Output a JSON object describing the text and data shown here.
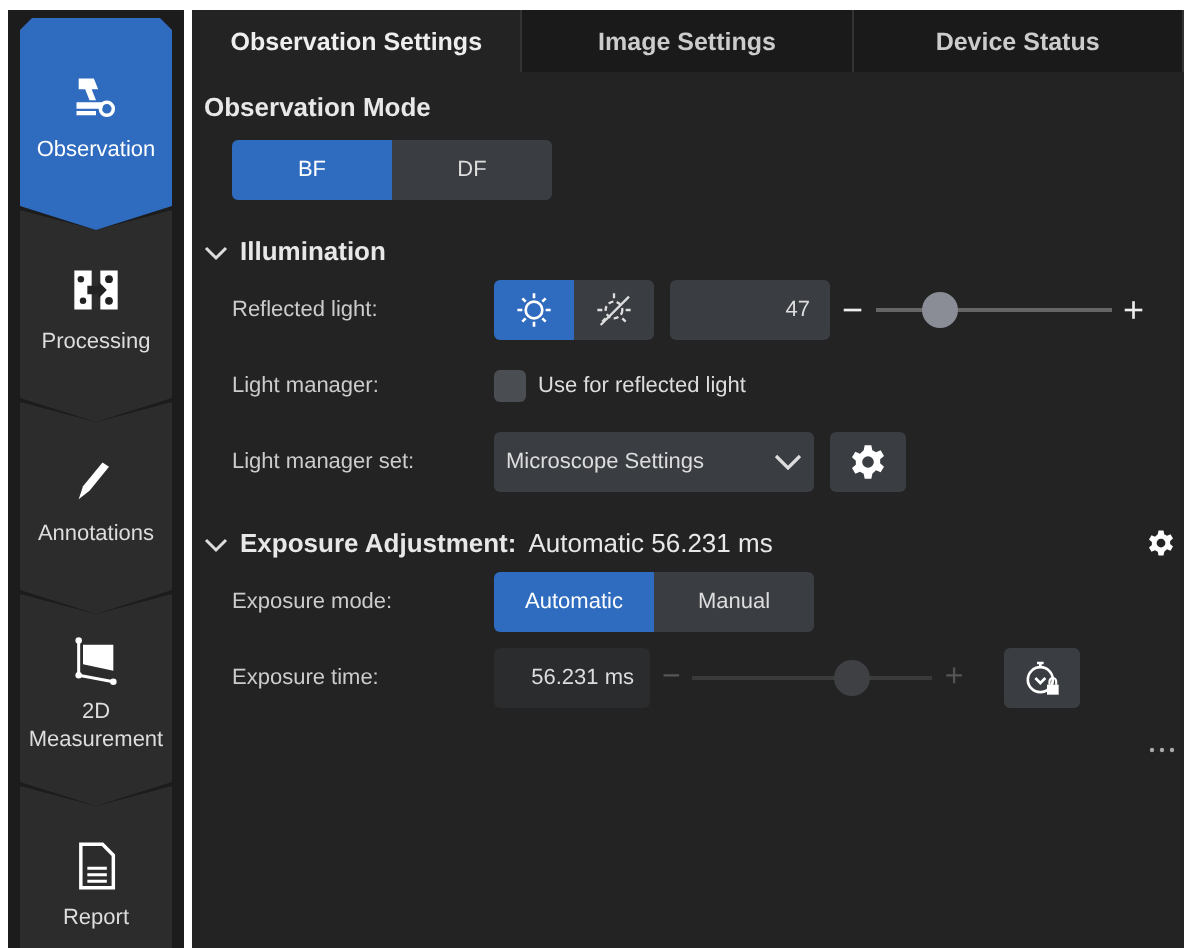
{
  "sidebar": {
    "items": [
      {
        "label": "Observation",
        "kind": "microscope",
        "selected": true
      },
      {
        "label": "Processing",
        "kind": "processing",
        "selected": false
      },
      {
        "label": "Annotations",
        "kind": "annotation",
        "selected": false
      },
      {
        "label": "2D Measurement",
        "kind": "measurement",
        "selected": false
      },
      {
        "label": "Report",
        "kind": "report",
        "selected": false
      }
    ]
  },
  "tabs": [
    {
      "label": "Observation Settings",
      "selected": true
    },
    {
      "label": "Image Settings",
      "selected": false
    },
    {
      "label": "Device Status",
      "selected": false
    }
  ],
  "observation_mode": {
    "title": "Observation Mode",
    "options": [
      {
        "label": "BF",
        "selected": true
      },
      {
        "label": "DF",
        "selected": false
      }
    ]
  },
  "illumination": {
    "title": "Illumination",
    "expanded": true,
    "reflected_light": {
      "label": "Reflected light:",
      "toggles": [
        {
          "kind": "light-on",
          "selected": true
        },
        {
          "kind": "light-off",
          "selected": false
        }
      ],
      "value": "47",
      "minus": "−",
      "plus": "+",
      "level": 0.23
    },
    "light_manager": {
      "label": "Light manager:",
      "checkbox_label": "Use for reflected light",
      "checked": false
    },
    "light_manager_set": {
      "label": "Light manager set:",
      "value": "Microscope Settings"
    }
  },
  "exposure": {
    "title": "Exposure Adjustment:",
    "summary": "Automatic 56.231 ms",
    "expanded": true,
    "mode": {
      "label": "Exposure mode:",
      "options": [
        {
          "label": "Automatic",
          "selected": true
        },
        {
          "label": "Manual",
          "selected": false
        }
      ]
    },
    "time": {
      "label": "Exposure time:",
      "value": "56.231 ms",
      "minus": "−",
      "plus": "+",
      "level": 0.69,
      "disabled": true
    }
  }
}
